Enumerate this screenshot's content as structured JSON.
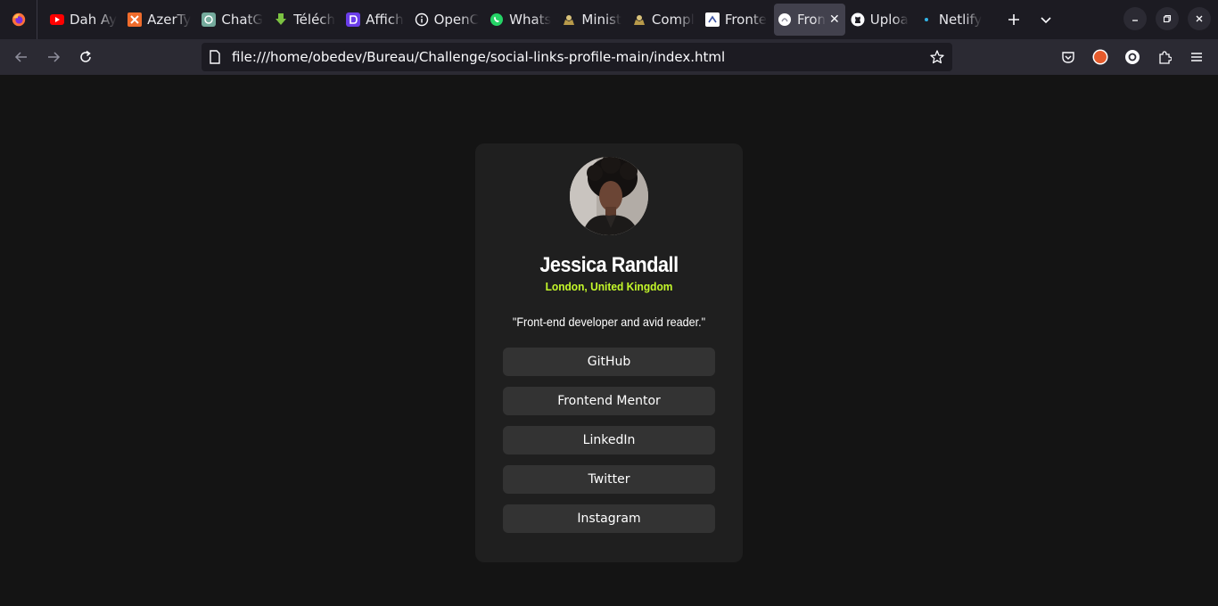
{
  "browser": {
    "tabs": [
      {
        "title": "Dah Ay",
        "icon": "youtube-icon"
      },
      {
        "title": "AzerTy",
        "icon": "azerty-icon"
      },
      {
        "title": "ChatG",
        "icon": "chatgpt-icon"
      },
      {
        "title": "Téléch",
        "icon": "download-icon"
      },
      {
        "title": "Affich",
        "icon": "affich-icon"
      },
      {
        "title": "OpenC",
        "icon": "info-icon"
      },
      {
        "title": "Whats",
        "icon": "whatsapp-icon"
      },
      {
        "title": "Minist",
        "icon": "ministry-icon"
      },
      {
        "title": "Compl",
        "icon": "ministry-icon"
      },
      {
        "title": "Fronte",
        "icon": "frontend-icon"
      },
      {
        "title": "Fron",
        "icon": "frontend-icon",
        "active": true
      },
      {
        "title": "Uploa",
        "icon": "github-icon"
      },
      {
        "title": "Netlify",
        "icon": "netlify-icon"
      }
    ],
    "url": "file:///home/obedev/Bureau/Challenge/social-links-profile-main/index.html"
  },
  "profile": {
    "name": "Jessica Randall",
    "location": "London, United Kingdom",
    "bio": "\"Front-end developer and avid reader.\"",
    "links": [
      "GitHub",
      "Frontend Mentor",
      "LinkedIn",
      "Twitter",
      "Instagram"
    ]
  },
  "colors": {
    "accent": "#c4f82a",
    "background": "#141414",
    "card": "#1f1f1f",
    "button": "#333333"
  }
}
